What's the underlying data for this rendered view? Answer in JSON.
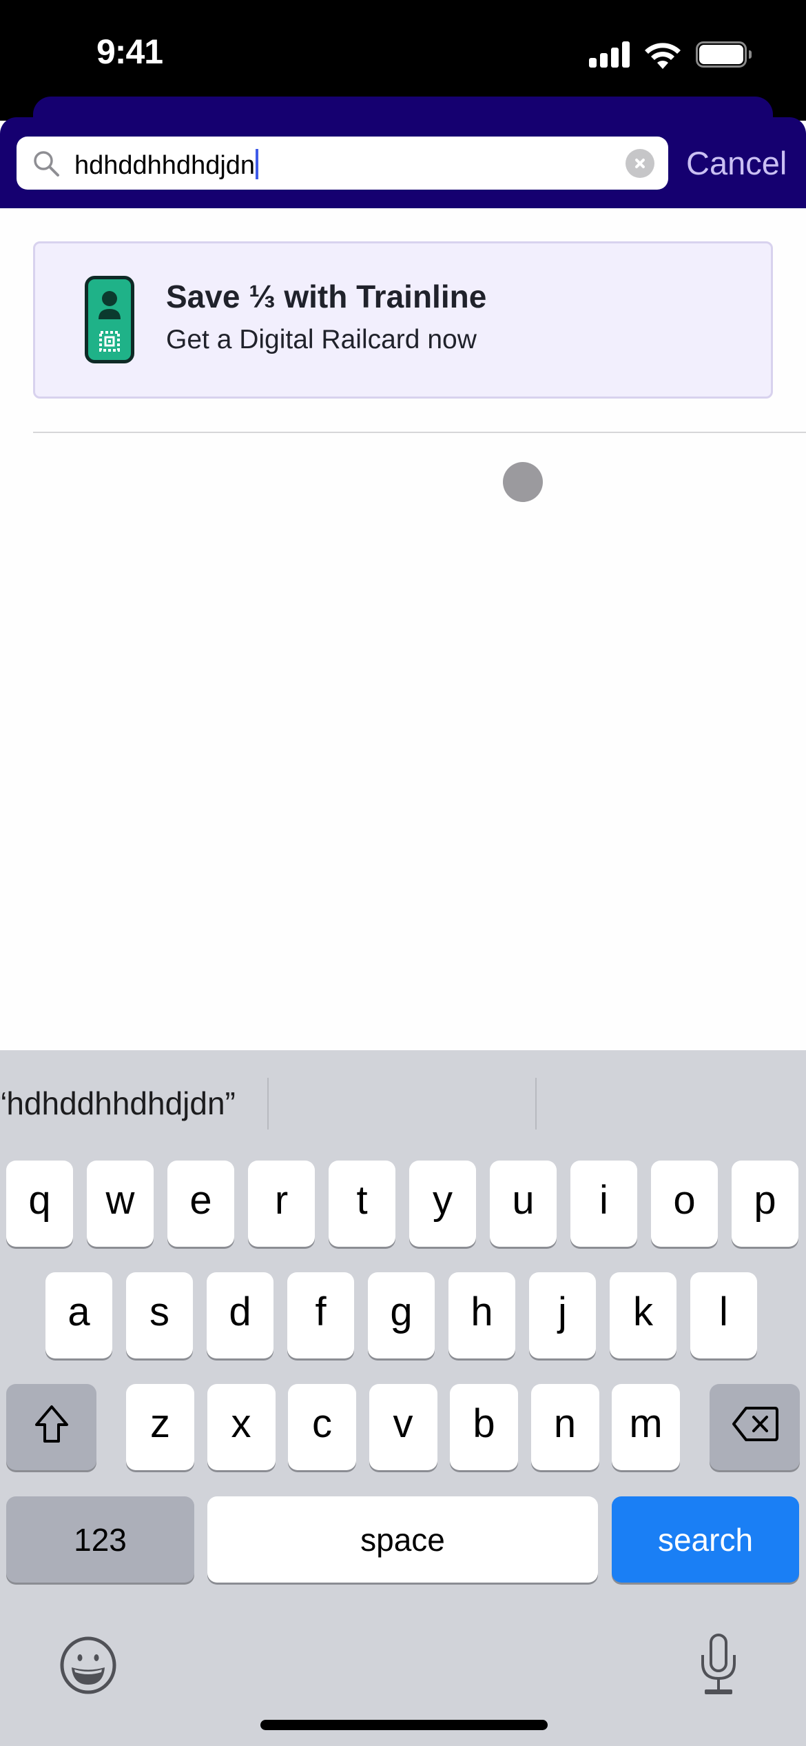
{
  "status_bar": {
    "time": "9:41",
    "icons": [
      "cellular-signal-icon",
      "wifi-icon",
      "battery-icon"
    ]
  },
  "header": {
    "search": {
      "value": "hdhddhhdhdjdn",
      "icon": "search-icon",
      "clear_icon": "clear-circle-icon"
    },
    "cancel_label": "Cancel",
    "background_color": "#150070",
    "cancel_color": "#cac0f3"
  },
  "promo": {
    "title": "Save ⅓ with Trainline",
    "subtitle": "Get a Digital Railcard now",
    "icon": "railcard-icon",
    "background_color": "#f2effd",
    "icon_color": "#1fb288"
  },
  "keyboard": {
    "suggestions": [
      "“hdhddhhdhdjdn”",
      "",
      ""
    ],
    "rows": [
      [
        "q",
        "w",
        "e",
        "r",
        "t",
        "y",
        "u",
        "i",
        "o",
        "p"
      ],
      [
        "a",
        "s",
        "d",
        "f",
        "g",
        "h",
        "j",
        "k",
        "l"
      ],
      [
        "z",
        "x",
        "c",
        "v",
        "b",
        "n",
        "m"
      ]
    ],
    "shift_icon": "shift-arrow-icon",
    "delete_icon": "backspace-icon",
    "numbers_label": "123",
    "space_label": "space",
    "return_label": "search",
    "return_color": "#1a7ff5",
    "emoji_icon": "emoji-icon",
    "mic_icon": "microphone-icon"
  }
}
